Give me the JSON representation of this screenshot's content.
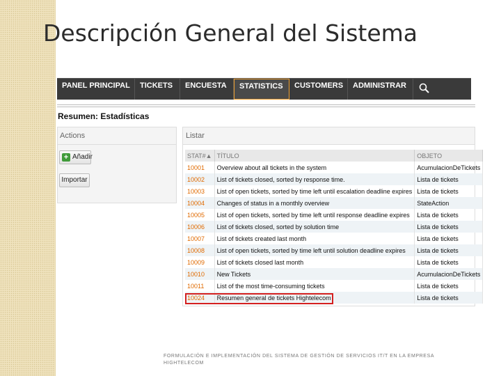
{
  "slide": {
    "title": "Descripción General del Sistema",
    "footer": "FORMULACIÓN E IMPLEMENTACIÓN DEL SISTEMA DE GESTIÓN DE SERVICIOS IT/T EN LA EMPRESA HIGHTELECOM"
  },
  "navbar": {
    "items": [
      "PANEL PRINCIPAL",
      "TICKETS",
      "ENCUESTA",
      "STATISTICS",
      "CUSTOMERS",
      "ADMINISTRAR"
    ],
    "active": "STATISTICS",
    "search_icon": "search-icon"
  },
  "page": {
    "heading": "Resumen: Estadísticas"
  },
  "actions": {
    "title": "Actions",
    "add_label": "Añadir",
    "import_label": "Importar"
  },
  "list": {
    "title": "Listar",
    "columns": [
      "STAT#▲",
      "TÍTULO",
      "OBJETO"
    ],
    "rows": [
      {
        "num": "10001",
        "title": "Overview about all tickets in the system",
        "object": "AcumulacionDeTickets"
      },
      {
        "num": "10002",
        "title": "List of tickets closed, sorted by response time.",
        "object": "Lista de tickets"
      },
      {
        "num": "10003",
        "title": "List of open tickets, sorted by time left until escalation deadline expires",
        "object": "Lista de tickets"
      },
      {
        "num": "10004",
        "title": "Changes of status in a monthly overview",
        "object": "StateAction"
      },
      {
        "num": "10005",
        "title": "List of open tickets, sorted by time left until response deadline expires",
        "object": "Lista de tickets"
      },
      {
        "num": "10006",
        "title": "List of tickets closed, sorted by solution time",
        "object": "Lista de tickets"
      },
      {
        "num": "10007",
        "title": "List of tickets created last month",
        "object": "Lista de tickets"
      },
      {
        "num": "10008",
        "title": "List of open tickets, sorted by time left until solution deadline expires",
        "object": "Lista de tickets"
      },
      {
        "num": "10009",
        "title": "List of tickets closed last month",
        "object": "Lista de tickets"
      },
      {
        "num": "10010",
        "title": "New Tickets",
        "object": "AcumulacionDeTickets"
      },
      {
        "num": "10011",
        "title": "List of the most time-consuming tickets",
        "object": "Lista de tickets"
      },
      {
        "num": "10024",
        "title": "Resumen general de tickets Hightelecom",
        "object": "Lista de tickets"
      }
    ],
    "highlighted_row": "10024"
  },
  "colors": {
    "accent_orange": "#e06a00",
    "highlight_red": "#d42020",
    "navbar_bg": "#3a3a3a"
  }
}
